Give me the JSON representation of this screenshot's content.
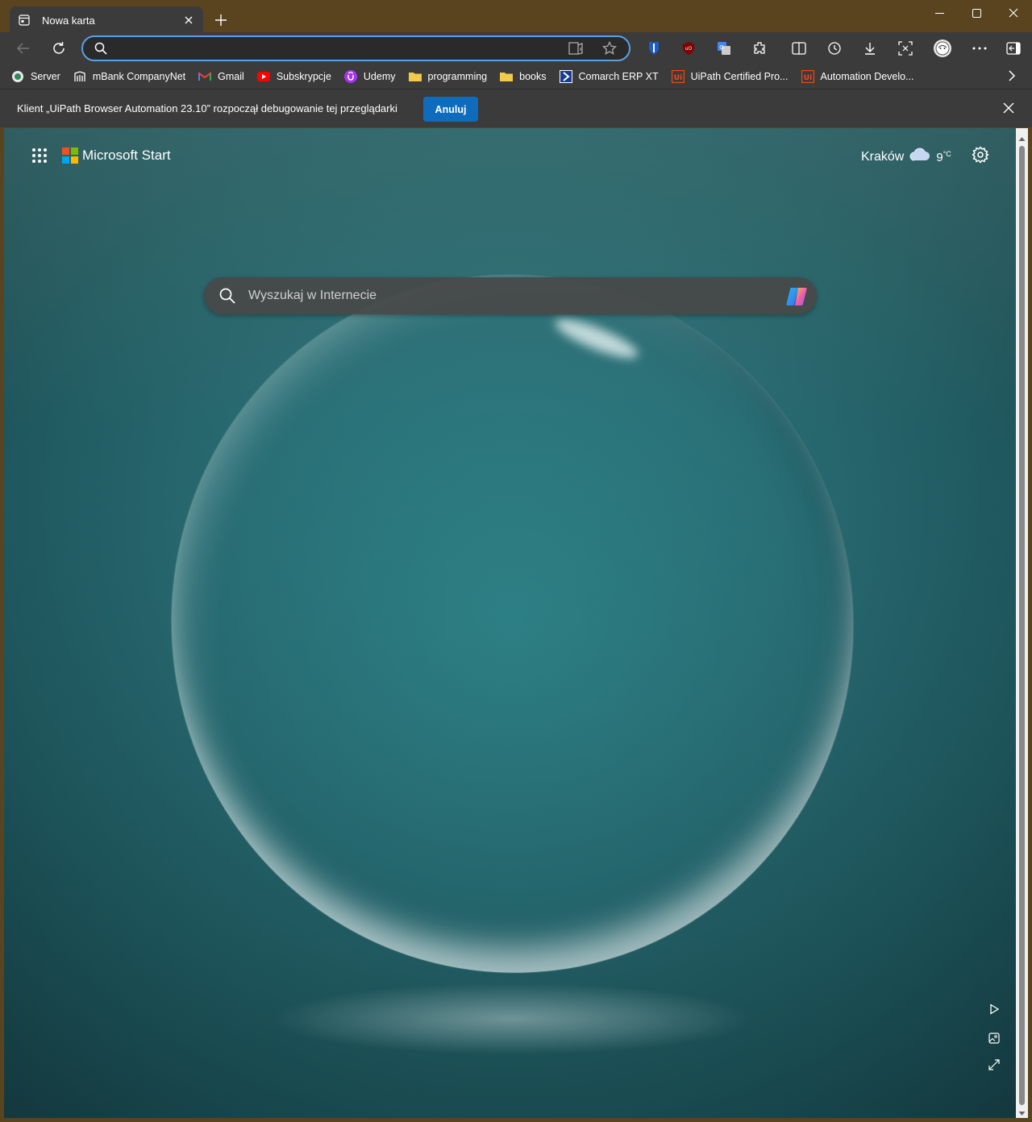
{
  "window": {
    "tab_title": "Nowa karta",
    "controls": [
      "minimize-icon",
      "maximize-icon",
      "close-icon"
    ]
  },
  "address_bar": {
    "value": "",
    "placeholder": ""
  },
  "bookmarks": [
    {
      "label": "Server",
      "icon": "server-icon",
      "color": "#2e8b57"
    },
    {
      "label": "mBank CompanyNet",
      "icon": "mbank-icon",
      "color": "#ffffff"
    },
    {
      "label": "Gmail",
      "icon": "gmail-icon",
      "color": "#ea4335"
    },
    {
      "label": "Subskrypcje",
      "icon": "youtube-icon",
      "color": "#ff0000"
    },
    {
      "label": "Udemy",
      "icon": "udemy-icon",
      "color": "#a435f0"
    },
    {
      "label": "programming",
      "icon": "folder-icon",
      "color": "#f2c94c"
    },
    {
      "label": "books",
      "icon": "folder-icon",
      "color": "#f2c94c"
    },
    {
      "label": "Comarch ERP XT",
      "icon": "comarch-icon",
      "color": "#1a3b8f"
    },
    {
      "label": "UiPath Certified Pro...",
      "icon": "uipath-icon",
      "color": "#fa4616"
    },
    {
      "label": "Automation Develo...",
      "icon": "uipath-icon",
      "color": "#fa4616"
    }
  ],
  "infobar": {
    "message": "Klient „UiPath Browser Automation 23.10” rozpoczął debugowanie tej przeglądarki",
    "button": "Anuluj"
  },
  "newtab": {
    "brand": "Microsoft Start",
    "city": "Kraków",
    "temperature": "9",
    "temperature_unit": "°C",
    "search_placeholder": "Wyszukaj w Internecie"
  },
  "colors": {
    "title_bar": "#5a4420",
    "chrome": "#3b3b3b",
    "accent": "#0f6cbd",
    "background": "#2a6f76"
  }
}
